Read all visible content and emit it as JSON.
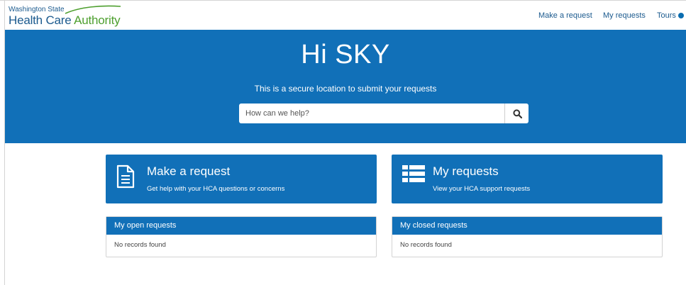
{
  "header": {
    "logo": {
      "line1": "Washington State",
      "line2_prefix": "Health Care ",
      "line2_accent": "Authority"
    },
    "nav": {
      "make_request": "Make a request",
      "my_requests": "My requests",
      "tours": "Tours"
    }
  },
  "hero": {
    "greeting": "Hi SKY",
    "subtitle": "This is a secure location to submit your requests",
    "search": {
      "placeholder": "How can we help?",
      "value": ""
    }
  },
  "cards": {
    "make_request": {
      "title": "Make a request",
      "subtitle": "Get help with your HCA questions or concerns"
    },
    "my_requests": {
      "title": "My requests",
      "subtitle": "View your HCA support requests"
    }
  },
  "panels": {
    "open": {
      "title": "My open requests",
      "empty": "No records found"
    },
    "closed": {
      "title": "My closed requests",
      "empty": "No records found"
    }
  },
  "icons": {
    "logo": "hca-swoosh-logo",
    "search": "search-icon",
    "make_request": "document-icon",
    "my_requests": "list-icon",
    "tours": "dot-icon"
  },
  "colors": {
    "primary": "#1170b8",
    "logo_blue": "#1b5a8e",
    "logo_green": "#4d9f2e"
  }
}
